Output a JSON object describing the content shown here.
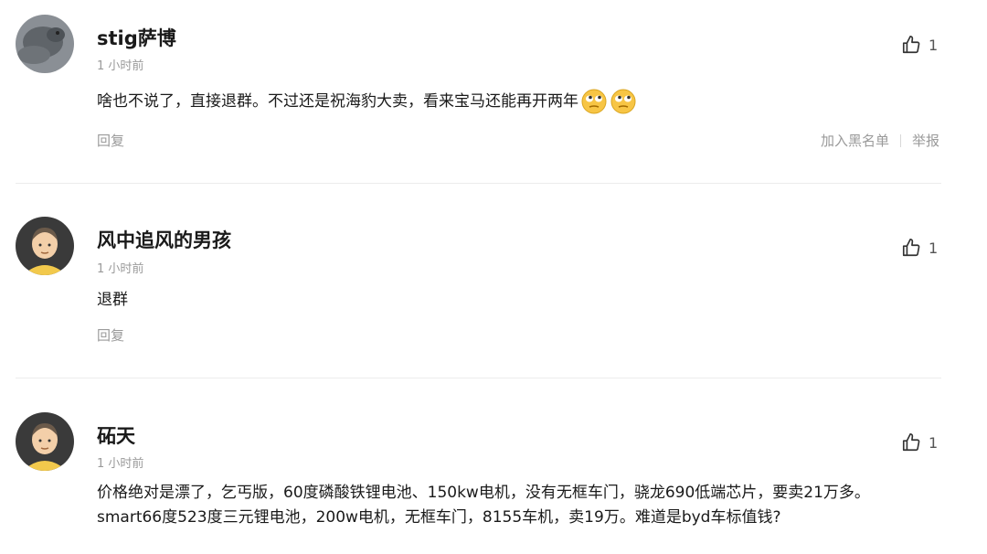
{
  "comments": [
    {
      "name": "stig萨博",
      "time": "1 小时前",
      "text": "啥也不说了，直接退群。不过还是祝海豹大卖，看来宝马还能再开两年",
      "emoji_icons": [
        "rolling-eyes-emoji-icon",
        "rolling-eyes-emoji-icon"
      ],
      "likes": "1",
      "reply_label": "回复",
      "blacklist_label": "加入黑名单",
      "report_label": "举报"
    },
    {
      "name": "风中追风的男孩",
      "time": "1 小时前",
      "text": "退群",
      "likes": "1",
      "reply_label": "回复"
    },
    {
      "name": "砳天",
      "time": "1 小时前",
      "text": "价格绝对是漂了，乞丐版，60度磷酸铁锂电池、150kw电机，没有无框车门，骁龙690低端芯片，要卖21万多。 smart66度523度三元锂电池，200w电机，无框车门，8155车机，卖19万。难道是byd车标值钱?",
      "likes": "1"
    }
  ],
  "colors": {
    "text": "#1a1a1a",
    "meta": "#9a9a9a",
    "divider": "#ececec",
    "avatar_skin": "#f3cfa9",
    "avatar_shirt": "#f2c94c"
  }
}
